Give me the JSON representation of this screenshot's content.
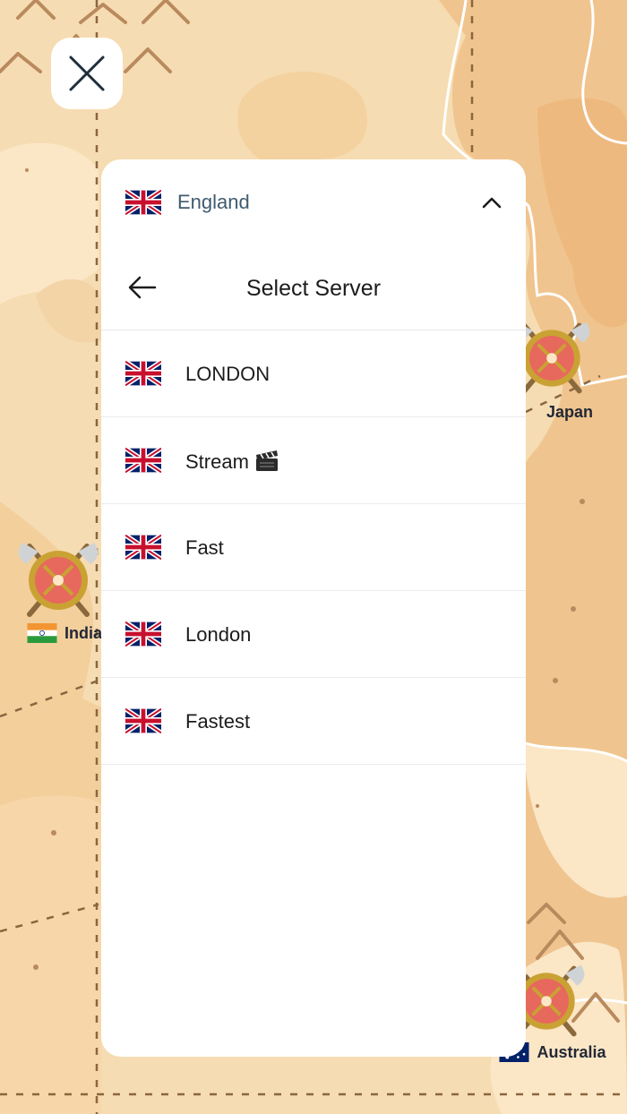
{
  "panel": {
    "country": {
      "flag_icon": "uk-flag-icon",
      "name": "England",
      "toggle_icon": "chevron-up-icon"
    },
    "header": {
      "back_icon": "arrow-left-icon",
      "title": "Select Server"
    },
    "servers": [
      {
        "name": "LONDON",
        "flag_icon": "uk-flag-icon"
      },
      {
        "name": "Stream",
        "flag_icon": "uk-flag-icon",
        "suffix_icon": "clapper-board-icon"
      },
      {
        "name": "Fast",
        "flag_icon": "uk-flag-icon"
      },
      {
        "name": "London",
        "flag_icon": "uk-flag-icon"
      },
      {
        "name": "Fastest",
        "flag_icon": "uk-flag-icon"
      }
    ]
  },
  "close_button": {
    "icon": "close-icon"
  },
  "map": {
    "markers": [
      {
        "label": "Japan",
        "icon": "viking-shield-icon"
      },
      {
        "label": "India",
        "icon": "viking-shield-icon",
        "flag_icon": "india-flag-icon"
      },
      {
        "label": "Australia",
        "icon": "viking-shield-icon",
        "flag_icon": "australia-flag-icon"
      }
    ]
  },
  "colors": {
    "map_sand": "#f6dcb2",
    "map_land_dark": "#f0c48e",
    "map_land_light": "#fbe6c6",
    "panel_bg": "#ffffff",
    "country_text": "#3f5b6f",
    "shield_red": "#e7685d",
    "shield_gold": "#c9a233"
  }
}
